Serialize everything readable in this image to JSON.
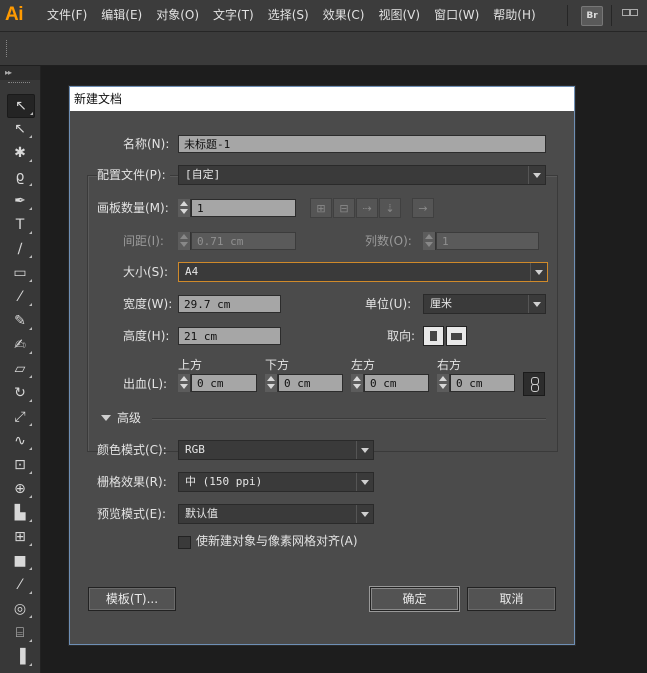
{
  "app": {
    "logo": "Ai",
    "bridge_label": "Br"
  },
  "menu": [
    "文件(F)",
    "编辑(E)",
    "对象(O)",
    "文字(T)",
    "选择(S)",
    "效果(C)",
    "视图(V)",
    "窗口(W)",
    "帮助(H)"
  ],
  "tools_header": "▸▸",
  "tools": [
    {
      "name": "selection-tool-icon",
      "glyph": "↖"
    },
    {
      "name": "direct-selection-tool-icon",
      "glyph": "↖"
    },
    {
      "name": "magic-wand-tool-icon",
      "glyph": "✱"
    },
    {
      "name": "lasso-tool-icon",
      "glyph": "ϱ"
    },
    {
      "name": "pen-tool-icon",
      "glyph": "✒"
    },
    {
      "name": "type-tool-icon",
      "glyph": "T"
    },
    {
      "name": "line-tool-icon",
      "glyph": "∕"
    },
    {
      "name": "rectangle-tool-icon",
      "glyph": "▭"
    },
    {
      "name": "paintbrush-tool-icon",
      "glyph": "⁄"
    },
    {
      "name": "pencil-tool-icon",
      "glyph": "✎"
    },
    {
      "name": "blob-brush-tool-icon",
      "glyph": "✍"
    },
    {
      "name": "eraser-tool-icon",
      "glyph": "▱"
    },
    {
      "name": "rotate-tool-icon",
      "glyph": "↻"
    },
    {
      "name": "scale-tool-icon",
      "glyph": "⤢"
    },
    {
      "name": "warp-tool-icon",
      "glyph": "∿"
    },
    {
      "name": "free-transform-tool-icon",
      "glyph": "⊡"
    },
    {
      "name": "shape-builder-tool-icon",
      "glyph": "⊕"
    },
    {
      "name": "graph-tool-icon",
      "glyph": "▙"
    },
    {
      "name": "mesh-tool-icon",
      "glyph": "⊞"
    },
    {
      "name": "gradient-tool-icon",
      "glyph": "■"
    },
    {
      "name": "eyedropper-tool-icon",
      "glyph": "⁄"
    },
    {
      "name": "blend-tool-icon",
      "glyph": "◎"
    },
    {
      "name": "symbol-sprayer-tool-icon",
      "glyph": "⌸"
    },
    {
      "name": "column-graph-tool-icon",
      "glyph": "▐"
    }
  ],
  "dialog": {
    "title": "新建文档",
    "name_label": "名称(N):",
    "name_value": "未标题-1",
    "profile_label": "配置文件(P):",
    "profile_value": "[自定]",
    "artboards_label": "画板数量(M):",
    "artboards_value": "1",
    "spacing_label": "间距(I):",
    "spacing_value": "0.71 cm",
    "columns_label": "列数(O):",
    "columns_value": "1",
    "size_label": "大小(S):",
    "size_value": "A4",
    "width_label": "宽度(W):",
    "width_value": "29.7 cm",
    "units_label": "单位(U):",
    "units_value": "厘米",
    "height_label": "高度(H):",
    "height_value": "21 cm",
    "orientation_label": "取向:",
    "bleed_label": "出血(L):",
    "bleed_top_label": "上方",
    "bleed_top_value": "0 cm",
    "bleed_bottom_label": "下方",
    "bleed_bottom_value": "0 cm",
    "bleed_left_label": "左方",
    "bleed_left_value": "0 cm",
    "bleed_right_label": "右方",
    "bleed_right_value": "0 cm",
    "advanced_label": "高级",
    "color_mode_label": "颜色模式(C):",
    "color_mode_value": "RGB",
    "raster_label": "栅格效果(R):",
    "raster_value": "中 (150 ppi)",
    "preview_label": "预览模式(E):",
    "preview_value": "默认值",
    "align_pixel_label": "使新建对象与像素网格对齐(A)",
    "templates_button": "模板(T)...",
    "ok_button": "确定",
    "cancel_button": "取消"
  }
}
